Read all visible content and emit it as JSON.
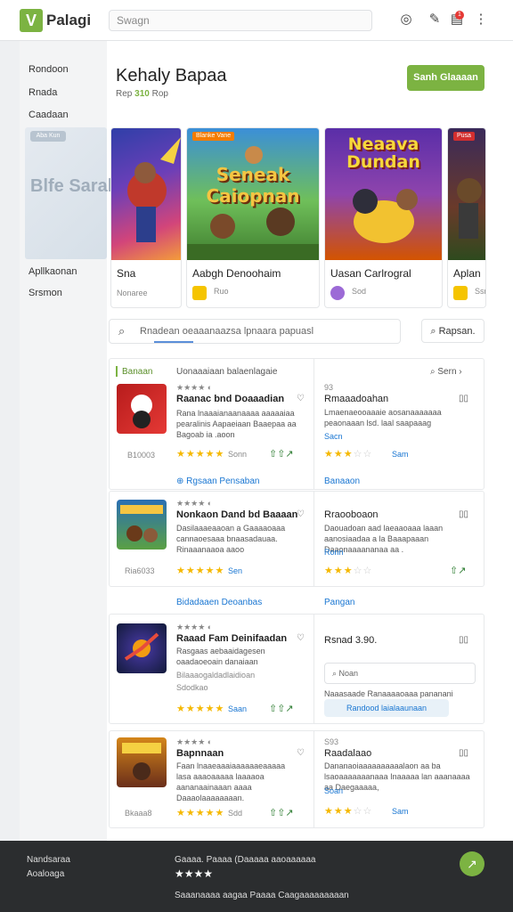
{
  "header": {
    "logo_glyph": "V",
    "brand": "Palagi",
    "search_placeholder": "Swagn",
    "icons": [
      "theme-icon",
      "tools-icon",
      "notifications-icon",
      "more-icon"
    ],
    "badge": "1"
  },
  "sidebar": {
    "items": [
      "Rondoon",
      "Rnada",
      "Caadaan"
    ],
    "items_lower": [
      "Apllkaonan",
      "Srsmon"
    ]
  },
  "page": {
    "title": "Kehaly Bapaa",
    "subtitle_pre": "Rep",
    "subtitle_hl": "310",
    "subtitle_post": "Rop",
    "cta": "Sanh Glaaaan"
  },
  "carousel": {
    "faded": {
      "tag": "Aba Kun",
      "art": "Blfe Sarab"
    },
    "cards": [
      {
        "title": "Sna",
        "meta": "Nonaree",
        "art": "",
        "tag": ""
      },
      {
        "title": "Aabgh Denoohaim",
        "meta": "Ruo",
        "art": "Seneak Caiopnan",
        "tag": "Blanke Vane"
      },
      {
        "title": "Uasan Carlrogral",
        "meta": "Sod",
        "art": "Neaava Dundan",
        "tag": ""
      },
      {
        "title": "Aplan",
        "meta": "Ssn",
        "art": "",
        "tag": "Pusa"
      }
    ]
  },
  "filter": {
    "placeholder": "Rnadean oeaaanaazsa lpnaara papuasl",
    "button": "Rapsan."
  },
  "sections": [
    {
      "left_label": "Banaan",
      "mid_label": "Uonaaaiaan balaenlagaie",
      "right_action": "Sern",
      "item": {
        "title": "Raanac bnd Doaaadian",
        "desc": "Rana lnaaaianaanaaaa aaaaaiaa pearalinis Aapaeiaan Baaepaa aa Bagoab ia .aoon",
        "id": "B10003",
        "rating": "Sonn"
      },
      "right": {
        "num": "93",
        "title": "Rmaaadoahan",
        "desc": "Lmaenaeooaaaie aosanaaaaaaa peaonaaan lsd. laal saapaaag",
        "link": "Sacn",
        "rating": "Sam"
      }
    },
    {
      "left_label": "Rgsaan Pensaban",
      "mid_label": "",
      "right_action": "",
      "section_link": "Banaaon",
      "item": {
        "title": "Nonkaon Dand bd Baaaan",
        "desc": "Dasilaaaeaaoan a Gaaaaoaaa cannaoesaaa bnaasadauaa. Rinaaanaaoa aaoo",
        "id": "Ria6033",
        "rating": "Sen"
      },
      "right": {
        "num": "",
        "title": "Rraooboaon",
        "desc": "Daouadoan aad laeaaoaaa laaan aanosiaadaa a la Baaapaaan Daaonaaaananaa aa .",
        "link": "Ronn",
        "rating": ""
      }
    },
    {
      "left_label": "Bidadaaen Deoanbas",
      "mid_label": "",
      "right_action": "",
      "section_link": "Pangan",
      "item": {
        "title": "Raaad Fam Deinifaadan",
        "desc": "Rasgaas aebaaidagesen oaadaoeoain danaiaan",
        "sub": "Bilaaaogaldadlaidioan",
        "id": "Sdodkao",
        "rating": "Saan"
      },
      "right": {
        "num": "",
        "title": "Rsnad 3.90.",
        "search": "Noan",
        "desc": "Naaasaade Ranaaaaoaaa pananani Ilnaaoan",
        "pill": "Randood laialaaunaan"
      }
    },
    {
      "left_label": "",
      "mid_label": "",
      "right_action": "",
      "item": {
        "title": "Bapnnaan",
        "desc": "Faan lnaaeaaaiaaaaaaeaaaaa lasa aaaoaaaaa laaaaoa aananaainaaan aaaa Daaaolaaaaaaaan.",
        "id": "Bkaaa8",
        "rating": "Sdd"
      },
      "right": {
        "num": "S93",
        "title": "Raadalaao",
        "desc": "Dananaoiaaaaaaaaaalaon aa ba lsaoaaaaaaanaaa Inaaaaa lan aaanaaaa aa Daegaaaaa,",
        "link": "Soan",
        "rating": "Sam"
      }
    }
  ],
  "footer": {
    "col1": [
      "Nandsaraa",
      "Aoaloaga"
    ],
    "col2": "Gaaaa. Paaaa (Daaaaa aaoaaaaaa",
    "stars": "★★★★",
    "bottom": "Saaanaaaa aagaa Paaaa Caagaaaaaaaaan",
    "fab_glyph": "↗"
  }
}
